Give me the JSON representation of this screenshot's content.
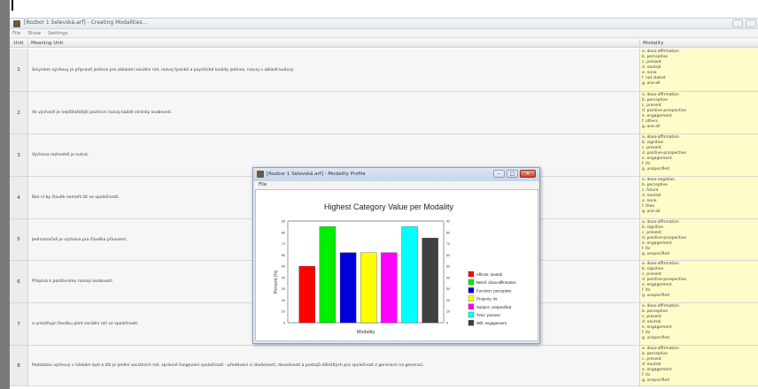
{
  "main_window": {
    "title": "[Rozbor 1 Selevská.arf] - Creating Modalities...",
    "menu": [
      "File",
      "Show",
      "Settings"
    ]
  },
  "grid": {
    "headers": {
      "unit": "Unit",
      "meaning": "Meaning Unit",
      "modality": "Modality"
    },
    "rows": [
      {
        "unit": "1",
        "text": "Smyslem výchovy je připravit jedince pro základní sociální roli, rozvoj fyzické a psychické kvality jedince, rozvoj v oblasti kultury.",
        "modality": [
          "a. doxa-affirmation",
          "b. perceptive",
          "c. present",
          "d. neutral",
          "e. none",
          "f. not stated",
          "g. one-all"
        ]
      },
      {
        "unit": "2",
        "text": "Ve výchově je nejdůležitější pozitivní rozvoj každé stránky osobnosti.",
        "modality": [
          "a. doxa-affirmation",
          "b. perceptive",
          "c. present",
          "d. positive-prospective",
          "e. engagement",
          "f. others",
          "g. one-all"
        ]
      },
      {
        "unit": "3",
        "text": "Výchova rozhodně je nutná.",
        "modality": [
          "a. doxa-affirmation",
          "b. signitive",
          "c. present",
          "d. positive-prospective",
          "e. engagement",
          "f. its",
          "g. unspecified"
        ]
      },
      {
        "unit": "4",
        "text": "Bez ní by člověk nemohl žít ve společnosti.",
        "modality": [
          "a. doxa-negation",
          "b. perceptive",
          "c. future",
          "d. neutral",
          "e. none",
          "f. thee",
          "g. one-all"
        ]
      },
      {
        "unit": "5",
        "text": "Jednoznačně je výchova pro člověka přínosem.",
        "modality": [
          "a. doxa-affirmation",
          "b. signitive",
          "c. present",
          "d. positive-prospective",
          "e. engagement",
          "f. its",
          "g. unspecified"
        ]
      },
      {
        "unit": "6",
        "text": "Přispívá k pozitivnímu rozvoji osobnosti.",
        "modality": [
          "a. doxa-affirmation",
          "b. signitive",
          "c. present",
          "d. positive-prospective",
          "e. engagement",
          "f. its",
          "g. unspecified"
        ]
      },
      {
        "unit": "7",
        "text": "a umožňuje člověku plnit sociální roli ve společnosti.",
        "modality": [
          "a. doxa-affirmation",
          "b. perceptive",
          "c. present",
          "d. neutral",
          "e. engagement",
          "f. its",
          "g. unspecified"
        ]
      },
      {
        "unit": "8",
        "text": "Podstatou výchovy v lidském bytí a žití je plnění sociálních rolí, správné fungování společnosti - předávání si zkušeností, dovedností a postojů důležitých pro společnost z generace na generaci.",
        "modality": [
          "a. doxa-affirmation",
          "b. perceptive",
          "c. present",
          "d. neutral",
          "e. engagement",
          "f. its",
          "g. unspecified"
        ]
      }
    ]
  },
  "dialog": {
    "title": "[Rozbor 1 Selevská.arf] - Modality Profile",
    "menu_file": "File",
    "controls": {
      "minimize": "–",
      "maximize": "□",
      "close": "×"
    }
  },
  "chart_data": {
    "type": "bar",
    "title": "Highest Category Value per Modality",
    "xlabel": "Modality",
    "ylabel": "Percent (%)",
    "ylim": [
      0,
      90
    ],
    "yticks": [
      0,
      10,
      20,
      30,
      40,
      50,
      60,
      70,
      80,
      90
    ],
    "grid": true,
    "legend_position": "right",
    "series": [
      {
        "name": "Affects:  neutral",
        "value": 50,
        "color": "#ff0000"
      },
      {
        "name": "Belief:  doxa-affirmation",
        "value": 85,
        "color": "#00ee00"
      },
      {
        "name": "Function:  perceptive",
        "value": 62,
        "color": "#0000dd"
      },
      {
        "name": "Property:  its",
        "value": 62,
        "color": "#ffff00"
      },
      {
        "name": "Subject:  unspecified",
        "value": 62,
        "color": "#ff00ff"
      },
      {
        "name": "Time:  present",
        "value": 85,
        "color": "#00ffff"
      },
      {
        "name": "Will:  engagement",
        "value": 75,
        "color": "#404040"
      }
    ]
  }
}
